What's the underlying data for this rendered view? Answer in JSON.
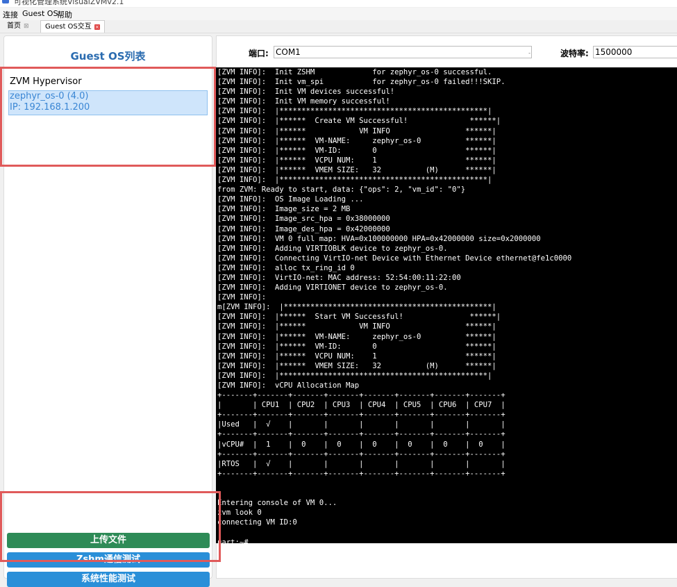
{
  "window": {
    "title": "可视化管理系统VisualZVMv2.1"
  },
  "menu": [
    "连接",
    "Guest OS",
    "帮助"
  ],
  "tabs": [
    {
      "label": "首页",
      "close": "⊠"
    },
    {
      "label": "Guest OS交互",
      "close": "×"
    }
  ],
  "left_panel": {
    "title": "Guest OS列表",
    "tree": {
      "root": "ZVM Hypervisor",
      "selected_line1": "zephyr_os-0 (4.0)",
      "selected_line2": "IP: 192.168.1.200"
    },
    "buttons": [
      "上传文件",
      "Zshm通信测试",
      "系统性能测试"
    ]
  },
  "serial": {
    "port_label": "端口:",
    "port_value": "COM1",
    "port_arrow": "-",
    "baud_label": "波特率:",
    "baud_value": "1500000"
  },
  "console_lines": [
    "[ZVM INFO]:  Init ZSHM             for zephyr_os-0 successful.",
    "[ZVM INFO]:  Init vm_spi           for zephyr_os-0 failed!!!SKIP.",
    "[ZVM INFO]:  Init VM devices successful!",
    "[ZVM INFO]:  Init VM memory successful!",
    "[ZVM INFO]:  |***********************************************|",
    "[ZVM INFO]:  |******  Create VM Successful!              ******|",
    "[ZVM INFO]:  |******            VM INFO                 ******|",
    "[ZVM INFO]:  |******  VM-NAME:     zephyr_os-0          ******|",
    "[ZVM INFO]:  |******  VM-ID:       0                    ******|",
    "[ZVM INFO]:  |******  VCPU NUM:    1                    ******|",
    "[ZVM INFO]:  |******  VMEM SIZE:   32          (M)      ******|",
    "[ZVM INFO]:  |***********************************************|",
    "from ZVM: Ready to start, data: {\"ops\": 2, \"vm_id\": \"0\"}",
    "[ZVM INFO]:  OS Image Loading ...",
    "[ZVM INFO]:  Image_size = 2 MB",
    "[ZVM INFO]:  Image_src_hpa = 0x38000000",
    "[ZVM INFO]:  Image_des_hpa = 0x42000000",
    "[ZVM INFO]:  VM 0 full map: HVA=0x100000000 HPA=0x42000000 size=0x2000000",
    "[ZVM INFO]:  Adding VIRTIOBLK device to zephyr_os-0.",
    "[ZVM INFO]:  Connecting VirtIO-net Device with Ethernet Device ethernet@fe1c0000",
    "[ZVM INFO]:  alloc tx_ring_id 0",
    "[ZVM INFO]:  VirtIO-net: MAC address: 52:54:00:11:22:00",
    "[ZVM INFO]:  Adding VIRTIONET device to zephyr_os-0.",
    "[ZVM INFO]:",
    "m[ZVM INFO]:  |***********************************************|",
    "[ZVM INFO]:  |******  Start VM Successful!               ******|",
    "[ZVM INFO]:  |******            VM INFO                 ******|",
    "[ZVM INFO]:  |******  VM-NAME:     zephyr_os-0          ******|",
    "[ZVM INFO]:  |******  VM-ID:       0                    ******|",
    "[ZVM INFO]:  |******  VCPU NUM:    1                    ******|",
    "[ZVM INFO]:  |******  VMEM SIZE:   32          (M)      ******|",
    "[ZVM INFO]:  |***********************************************|",
    "[ZVM INFO]:  vCPU Allocation Map",
    "+-------+-------+-------+-------+-------+-------+-------+-------+",
    "|       | CPU1  | CPU2  | CPU3  | CPU4  | CPU5  | CPU6  | CPU7  |",
    "+-------+-------+-------+-------+-------+-------+-------+-------+",
    "|Used   |  √    |       |       |       |       |       |       |",
    "+-------+-------+-------+-------+-------+-------+-------+-------+",
    "|vCPU#  |  1    |  0    |  0    |  0    |  0    |  0    |  0    |",
    "+-------+-------+-------+-------+-------+-------+-------+-------+",
    "|RTOS   |  √    |       |       |       |       |       |       |",
    "+-------+-------+-------+-------+-------+-------+-------+-------+",
    "",
    "",
    "Entering console of VM 0...",
    "zvm look 0",
    "connecting VM ID:0",
    "",
    "uart:~#"
  ]
}
